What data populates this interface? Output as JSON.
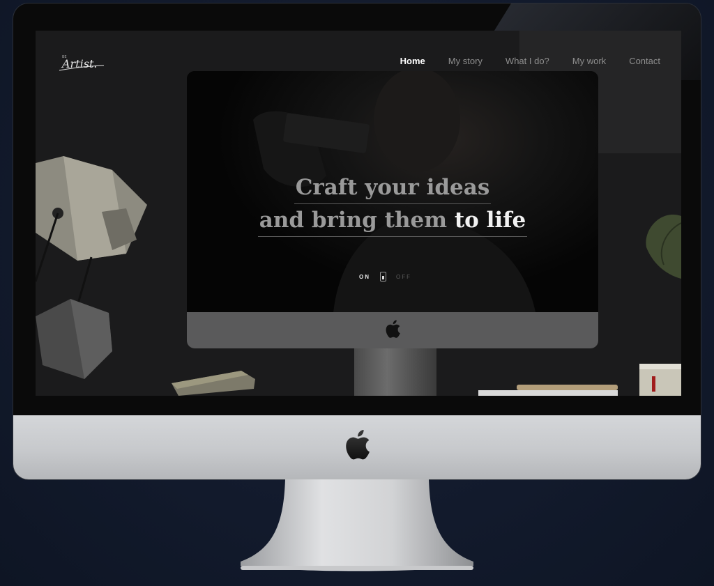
{
  "brand": {
    "logo_text": "Artist.",
    "logo_prefix": "BE"
  },
  "nav": {
    "items": [
      {
        "label": "Home",
        "active": true
      },
      {
        "label": "My story",
        "active": false
      },
      {
        "label": "What I do?",
        "active": false
      },
      {
        "label": "My work",
        "active": false
      },
      {
        "label": "Contact",
        "active": false
      }
    ]
  },
  "hero": {
    "line1": "Craft your ideas",
    "line2_a": "and bring them ",
    "line2_b": "to life"
  },
  "toggle": {
    "on_label": "ON",
    "off_label": "OFF"
  },
  "icons": [
    "apple-logo-icon"
  ],
  "colors": {
    "background": "#121a2c",
    "screen": "#1b1b1c",
    "accent_text": "#ffffff",
    "muted_text": "#8e8e8e"
  }
}
